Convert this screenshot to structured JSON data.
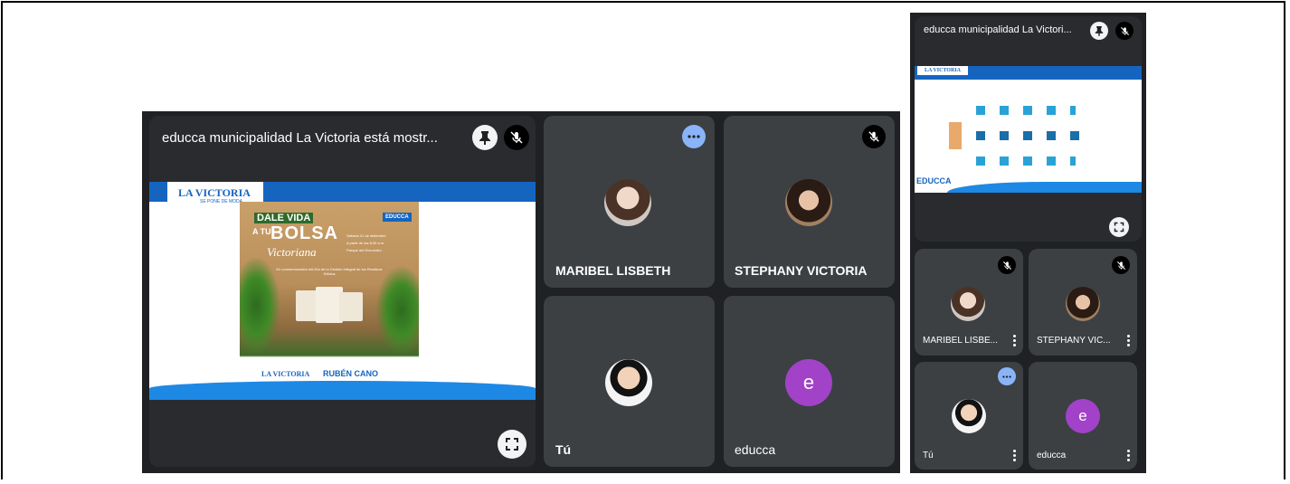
{
  "main_view": {
    "presenter_title": "educca municipalidad La Victoria está mostr...",
    "tiles": [
      {
        "name": "MARIBEL LISBETH",
        "initial": ""
      },
      {
        "name": "STEPHANY VICTORIA",
        "initial": ""
      },
      {
        "name": "Tú",
        "initial": ""
      },
      {
        "name": "educca",
        "initial": "e"
      }
    ]
  },
  "slide": {
    "logo_brand": "LA VICTORIA",
    "logo_tagline": "SE PONE DE MODA",
    "poster_line1": "DALE VIDA",
    "poster_line2": "A TU",
    "poster_line3": "BOLSA",
    "poster_line4": "Victoriana",
    "poster_badge": "EDUCCA",
    "event_date": "Sábado 21 de setiembre",
    "event_time": "A partir de las 8:30 a.m.",
    "event_place": "Parque del Encuentro",
    "event_sub": "En conmemoración del Día de la Gestión Integral de los Residuos Sólidos",
    "footer_brand": "LA VICTORIA",
    "footer_name": "RUBÉN CANO"
  },
  "side_view": {
    "presenter_title": "educca municipalidad La Victori...",
    "slide_brand": "LA VICTORIA",
    "slide_label": "EDUCCA",
    "tiles": [
      {
        "name": "MARIBEL LISBE...",
        "initial": ""
      },
      {
        "name": "STEPHANY VIC...",
        "initial": ""
      },
      {
        "name": "Tú",
        "initial": ""
      },
      {
        "name": "educca",
        "initial": "e"
      }
    ]
  },
  "colors": {
    "meet_bg": "#202124",
    "tile_bg": "#3c4043",
    "accent_blue": "#1565c0",
    "avatar_purple": "#a142c8",
    "more_blue": "#8ab4f8"
  },
  "icons": [
    "pin-icon",
    "mic-off-icon",
    "fullscreen-icon",
    "more-options-icon",
    "kebab-menu-icon"
  ]
}
